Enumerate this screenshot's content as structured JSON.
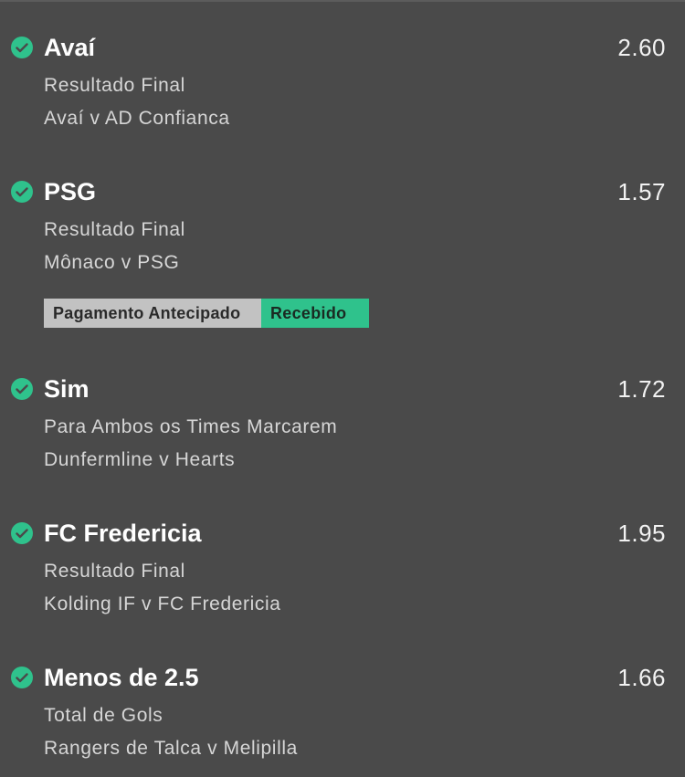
{
  "bets": [
    {
      "selection": "Avaí",
      "odds": "2.60",
      "market": "Resultado Final",
      "event": "Avaí v AD Confianca",
      "status_icon": "check-circle-icon"
    },
    {
      "selection": "PSG",
      "odds": "1.57",
      "market": "Resultado Final",
      "event": "Mônaco v PSG",
      "status_icon": "check-circle-icon",
      "early_payout": {
        "label": "Pagamento Antecipado",
        "status": "Recebido"
      }
    },
    {
      "selection": "Sim",
      "odds": "1.72",
      "market": "Para Ambos os Times Marcarem",
      "event": "Dunfermline v Hearts",
      "status_icon": "check-circle-icon"
    },
    {
      "selection": "FC Fredericia",
      "odds": "1.95",
      "market": "Resultado Final",
      "event": "Kolding IF v FC Fredericia",
      "status_icon": "check-circle-icon"
    },
    {
      "selection": "Menos de 2.5",
      "odds": "1.66",
      "market": "Total de Gols",
      "event": "Rangers de Talca v Melipilla",
      "status_icon": "check-circle-icon"
    }
  ],
  "colors": {
    "background": "#4a4a4a",
    "success": "#2fc28c",
    "badge_grey": "#c2c2c2"
  }
}
